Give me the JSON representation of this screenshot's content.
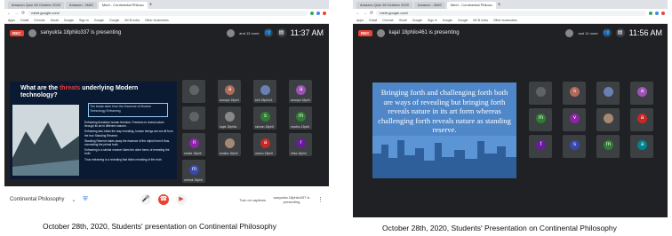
{
  "left": {
    "tabs": [
      "Amazon Quiz 28 October 2020",
      "Amazon - MAS",
      "Meet - Continental Philoso"
    ],
    "url": "meet.google.com/",
    "bookmarks": [
      "Apps",
      "Gmail",
      "Chrome",
      "Gmail",
      "Google",
      "Sign in",
      "Google",
      "Google",
      "MCN India",
      "Other bookmarks"
    ],
    "presenter": "sanyukta 18philo337 is presenting",
    "others": "and 13 more",
    "clock": "11:37 AM",
    "slide": {
      "title_part1": "What are the ",
      "title_emph": "threats",
      "title_part2": " underlying Modern technology?",
      "box_text": "The treats stem from the Essence of Modern Technology Enframing",
      "bullets": [
        "Enframing threatens human freedom. Freedom to reveal nature through its art in different manner.",
        "Enframing also hides the way revealing, human beings are cut off from the true Standing Reserve.",
        "Standing Reserve takes away the essence of the object from it thus, concealing the primal truth.",
        "Enframing is a similar manner hides the older forms of revealing the truth.",
        "Thus enframing is a revealing that hides revealing of the truth."
      ]
    },
    "tiles": [
      {
        "name": "",
        "letter": ""
      },
      {
        "name": "ananya 18phil",
        "letter": "a",
        "color": "#b06a58"
      },
      {
        "name": "kirti 18philo1",
        "letter": "",
        "color": "#6a80b0"
      },
      {
        "name": "ananya 18phil",
        "letter": "a",
        "color": "#9c53b4"
      },
      {
        "name": "",
        "letter": ""
      },
      {
        "name": "kajal 18philo",
        "letter": "",
        "color": "#888"
      },
      {
        "name": "simran 18phil",
        "letter": "s",
        "color": "#2e7d32"
      },
      {
        "name": "madhu 18phil",
        "letter": "m",
        "color": "#2e7d32"
      },
      {
        "name": "nimila 18phil",
        "letter": "n",
        "color": "#8e24aa"
      },
      {
        "name": "kanika 18phil",
        "letter": "",
        "color": "#a58872"
      },
      {
        "name": "anshu 18phil",
        "letter": "a",
        "color": "#c62828"
      },
      {
        "name": "ritika 18phil",
        "letter": "r",
        "color": "#6a1b9a"
      },
      {
        "name": "mehak 18phil",
        "letter": "m",
        "color": "#3949ab"
      }
    ],
    "meeting_name": "Continental Philosophy",
    "captions_label": "Turn on captions",
    "presenting_label": "sanyukta 18philo337 is presenting"
  },
  "right": {
    "tabs": [
      "Amazon Quiz 28 October 2020",
      "Amazon - MAS",
      "Meet - Continental Philoso"
    ],
    "url": "meet.google.com/",
    "bookmarks": [
      "Apps",
      "Gmail",
      "Chrome",
      "Gmail",
      "Google",
      "Sign in",
      "Google",
      "Google",
      "MCN India",
      "Other bookmarks"
    ],
    "presenter": "kajal 18philo461 is presenting",
    "others": "and 11 more",
    "clock": "11:56 AM",
    "slide_text": "Bringing forth and challenging forth both are ways of revealing but bringing forth reveals nature in its art form whereas challenging forth reveals nature as standing reserve.",
    "tiles": [
      {
        "name": "",
        "letter": ""
      },
      {
        "name": "",
        "letter": "s",
        "color": "#b06a58"
      },
      {
        "name": "",
        "letter": "",
        "color": "#6a80b0"
      },
      {
        "name": "",
        "letter": "a",
        "color": "#9c53b4"
      },
      {
        "name": "",
        "letter": "m",
        "color": "#2e7d32"
      },
      {
        "name": "",
        "letter": "v",
        "color": "#8e24aa"
      },
      {
        "name": "",
        "letter": "",
        "color": "#a58872"
      },
      {
        "name": "",
        "letter": "a",
        "color": "#c62828"
      },
      {
        "name": "",
        "letter": "f",
        "color": "#6a1b9a"
      },
      {
        "name": "",
        "letter": "s",
        "color": "#3949ab"
      },
      {
        "name": "",
        "letter": "m",
        "color": "#2e7d32"
      },
      {
        "name": "",
        "letter": "a",
        "color": "#00838f"
      }
    ]
  },
  "captions": {
    "left": "October 28th, 2020, Students' presentation on Continental Philosophy",
    "right": "October 28th, 2020, Students' Presentation on Continental Philosophy"
  }
}
